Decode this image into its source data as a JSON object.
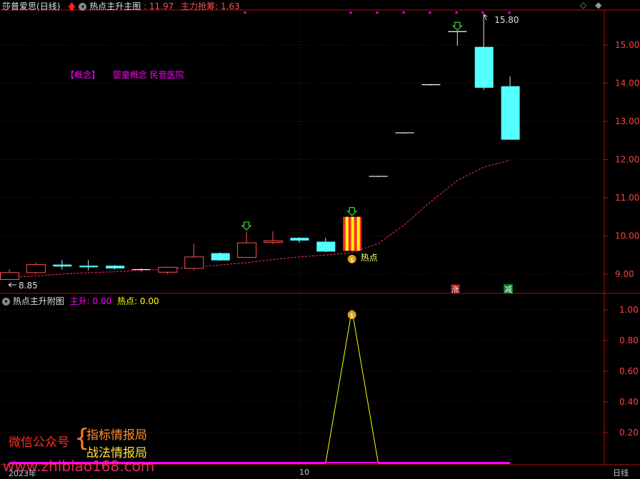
{
  "header": {
    "stock_name": "莎普爱思",
    "period": "(日线)",
    "indicator_name": "热点主升主图",
    "value1_label": "11.97",
    "value2_label": "主力抢筹: 1.63"
  },
  "concept": {
    "tag": "【概念】",
    "text": "婴童概念 民营医院"
  },
  "sub_header": {
    "name": "热点主升附图",
    "zhusheng_label": "主升: 0.00",
    "redian_label": "热点: 0.00"
  },
  "price_labels": {
    "high": "15.80",
    "low": "8.85",
    "hot_label": "热点",
    "zhang_badge": "涨",
    "jian_badge": "减"
  },
  "x_axis": {
    "year_label": "2023年",
    "month_label": "10",
    "period_button": "日线"
  },
  "watermark": {
    "left": "微信公众号",
    "right_top": "指标情报局",
    "right_bottom": "战法情报局",
    "site": "www.zhibiao168.com"
  },
  "colors": {
    "up": "#ff5050",
    "down": "#54ffff",
    "axis": "#b01010",
    "grid": "#601010",
    "ma": "#ff2a6a",
    "arrow": "#32e032",
    "hot_yellow": "#ffff00",
    "purple": "#ff00ff"
  },
  "chart_data": [
    {
      "type": "candlestick",
      "title": "热点主升主图",
      "ylim": [
        8.6,
        15.9
      ],
      "yticks": [
        9,
        10,
        11,
        12,
        13,
        14,
        15
      ],
      "candles": [
        {
          "o": 8.86,
          "h": 9.13,
          "l": 8.85,
          "c": 9.04
        },
        {
          "o": 9.04,
          "h": 9.3,
          "l": 9.0,
          "c": 9.25
        },
        {
          "o": 9.25,
          "h": 9.37,
          "l": 9.12,
          "c": 9.2
        },
        {
          "o": 9.22,
          "h": 9.37,
          "l": 9.1,
          "c": 9.18
        },
        {
          "o": 9.22,
          "h": 9.24,
          "l": 9.12,
          "c": 9.15
        },
        {
          "o": 9.1,
          "h": 9.16,
          "l": 9.05,
          "c": 9.12
        },
        {
          "o": 9.05,
          "h": 9.2,
          "l": 9.0,
          "c": 9.18
        },
        {
          "o": 9.15,
          "h": 9.8,
          "l": 9.1,
          "c": 9.45
        },
        {
          "o": 9.55,
          "h": 9.57,
          "l": 9.35,
          "c": 9.36
        },
        {
          "o": 9.44,
          "h": 10.12,
          "l": 9.44,
          "c": 9.82
        },
        {
          "o": 9.83,
          "h": 10.12,
          "l": 9.78,
          "c": 9.87
        },
        {
          "o": 9.95,
          "h": 9.97,
          "l": 9.82,
          "c": 9.88
        },
        {
          "o": 9.85,
          "h": 9.95,
          "l": 9.58,
          "c": 9.59
        },
        {
          "o": 9.61,
          "h": 10.5,
          "l": 9.6,
          "c": 10.5
        },
        {
          "o": 11.56,
          "h": 11.56,
          "l": 11.54,
          "c": 11.55
        },
        {
          "o": 12.7,
          "h": 12.7,
          "l": 12.68,
          "c": 12.69
        },
        {
          "o": 13.96,
          "h": 13.96,
          "l": 13.94,
          "c": 13.95
        },
        {
          "o": 15.35,
          "h": 15.35,
          "l": 14.98,
          "c": 15.34
        },
        {
          "o": 14.95,
          "h": 15.8,
          "l": 13.82,
          "c": 13.88
        },
        {
          "o": 13.92,
          "h": 14.18,
          "l": 12.52,
          "c": 12.52
        }
      ],
      "ma_line": [
        8.92,
        8.95,
        9.0,
        9.04,
        9.06,
        9.1,
        9.13,
        9.18,
        9.24,
        9.3,
        9.38,
        9.45,
        9.5,
        9.56,
        9.8,
        10.3,
        10.9,
        11.45,
        11.8,
        11.98
      ],
      "signal_arrows": [
        9,
        13,
        17
      ],
      "hot_index": 13,
      "high_index": 18,
      "low_index": 0
    },
    {
      "type": "line",
      "title": "热点主升附图",
      "ylim": [
        0,
        1.08
      ],
      "yticks": [
        0.2,
        0.4,
        0.6,
        0.8,
        1.0
      ],
      "series": [
        {
          "name": "热点",
          "values": [
            0,
            0,
            0,
            0,
            0,
            0,
            0,
            0,
            0,
            0,
            0,
            0,
            0,
            1,
            0,
            0,
            0,
            0,
            0,
            0
          ]
        },
        {
          "name": "主升",
          "values": [
            0,
            0,
            0,
            0,
            0,
            0,
            0,
            0,
            0,
            0,
            0,
            0,
            0,
            0,
            0,
            0,
            0,
            0,
            0,
            0
          ]
        }
      ]
    }
  ]
}
